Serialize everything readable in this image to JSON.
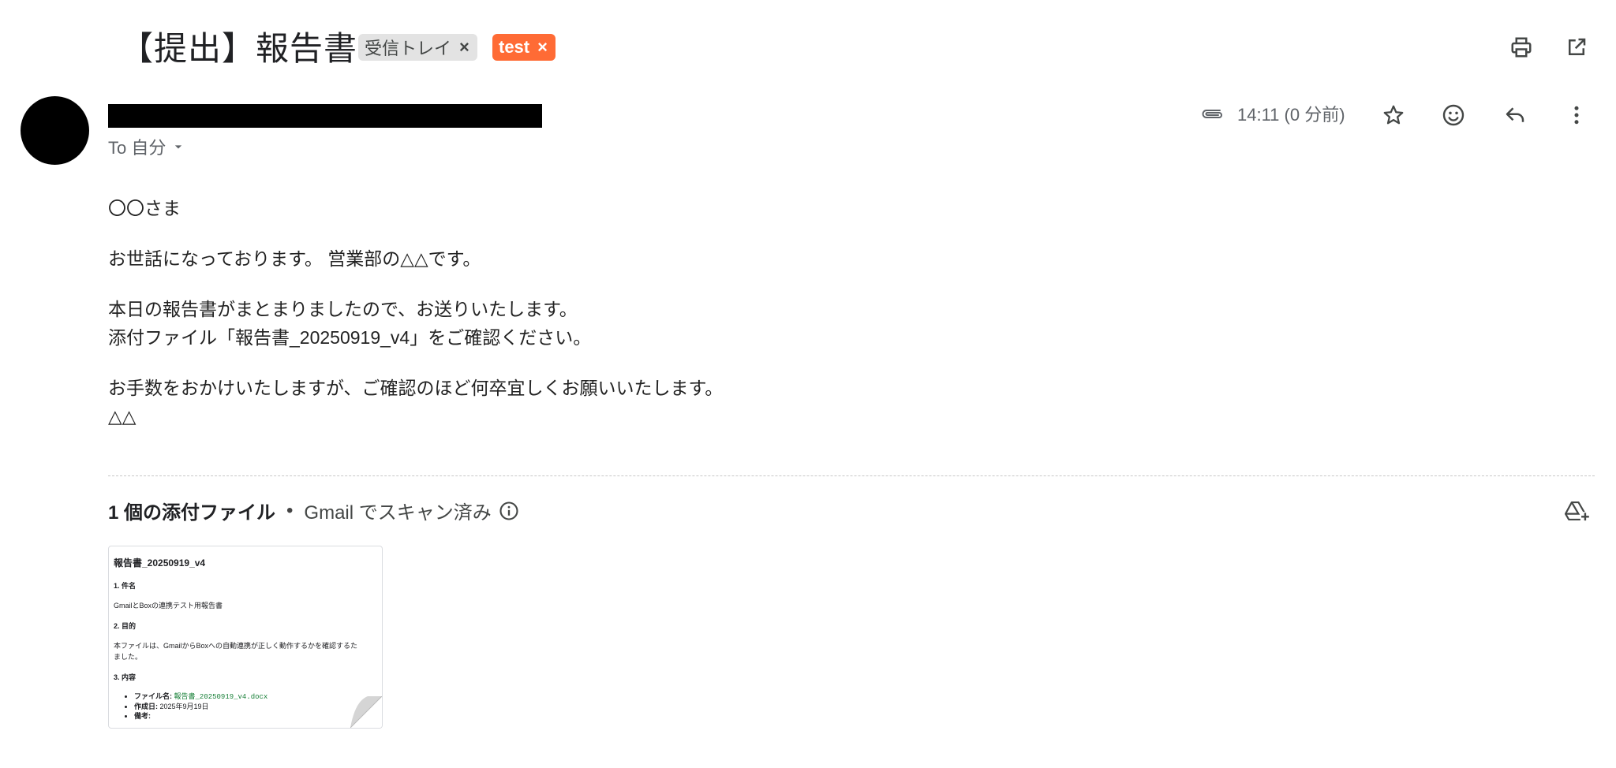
{
  "subject": "【提出】報告書",
  "labels": [
    {
      "text": "受信トレイ",
      "remove": "×"
    },
    {
      "text": "test",
      "remove": "×"
    }
  ],
  "header": {
    "to": "To 自分",
    "time": "14:11 (0 分前)"
  },
  "icons": {
    "print": "print-icon",
    "popout": "open-in-new-window-icon",
    "attachment": "paperclip-icon",
    "star": "star-icon",
    "emoji": "smiley-icon",
    "reply": "reply-icon",
    "more": "more-vert-icon",
    "info": "info-icon",
    "drive": "add-to-drive-icon",
    "dropdown": "caret-down-icon"
  },
  "body": {
    "greeting": "〇〇さま",
    "intro": "お世話になっております。 営業部の△△です。",
    "line1": "本日の報告書がまとまりましたので、お送りいたします。",
    "line2": "添付ファイル「報告書_20250919_v4」をご確認ください。",
    "line3": "お手数をおかけいたしますが、ご確認のほど何卒宜しくお願いいたします。",
    "signature": "△△"
  },
  "attachments": {
    "count_label": "1 個の添付ファイル",
    "separator": "•",
    "scan_label": "Gmail でスキャン済み",
    "preview": {
      "title": "報告書_20250919_v4",
      "h1": "1. 件名",
      "p1": "GmailとBoxの連携テスト用報告書",
      "h2": "2. 目的",
      "p2a": "本ファイルは、GmailからBoxへの自動連携が正しく動作するかを確認するた",
      "p2b": "ました。",
      "h3": "3. 内容",
      "items": [
        {
          "key": "ファイル名:",
          "value": "報告書_20250919_v4.docx"
        },
        {
          "key": "作成日:",
          "value": "2025年9月19日"
        },
        {
          "key": "備考:",
          "value": ""
        }
      ]
    }
  },
  "colors": {
    "test_label": "#ff6b35",
    "inbox_label": "#e3e3e3",
    "filename_green": "#188038"
  }
}
